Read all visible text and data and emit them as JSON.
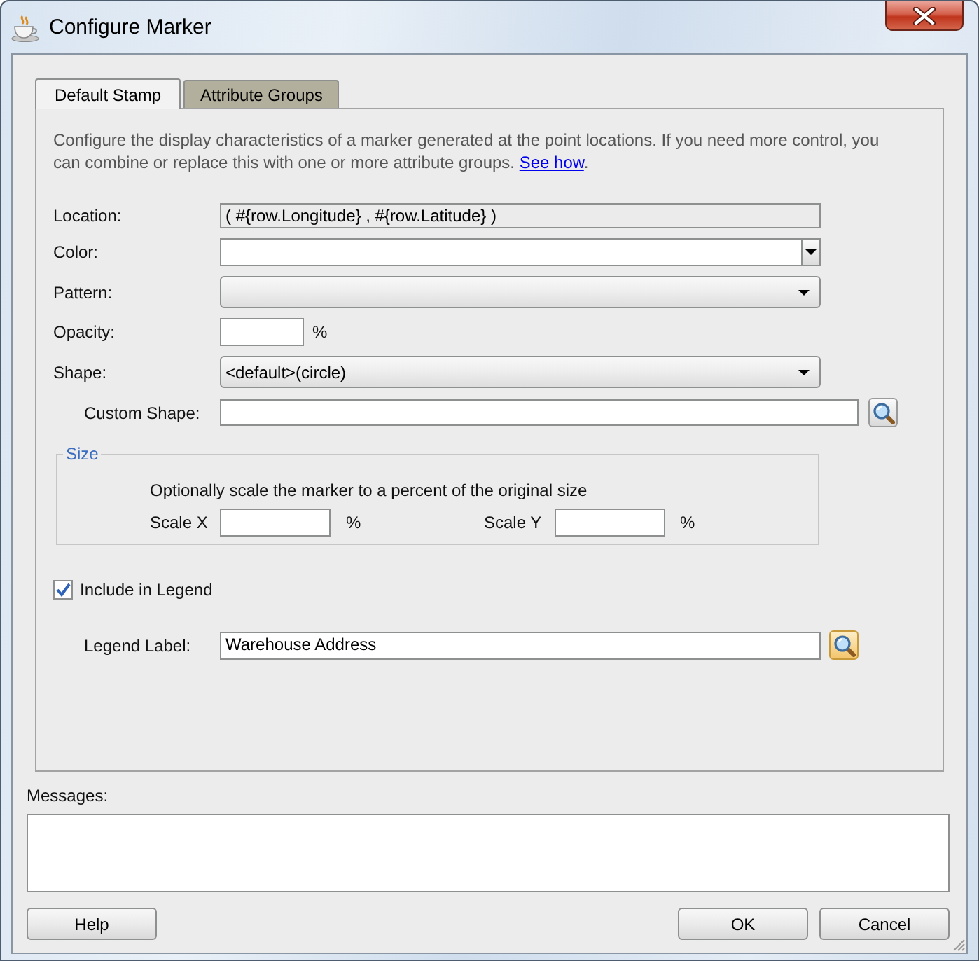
{
  "window": {
    "title": "Configure Marker"
  },
  "tabs": [
    {
      "label": "Default Stamp",
      "selected": true
    },
    {
      "label": "Attribute Groups",
      "selected": false
    }
  ],
  "description": {
    "text": "Configure the display characteristics of a marker generated at the point locations. If you need more control, you can combine or replace this with one or more attribute groups.",
    "link": "See how",
    "end": "."
  },
  "fields": [
    {
      "kind": "readonly",
      "label": "Location:",
      "value": "( #{row.Longitude} , #{row.Latitude} )"
    },
    {
      "kind": "editable-combo",
      "label": "Color:"
    },
    {
      "kind": "combo",
      "label": "Pattern:"
    },
    {
      "kind": "percent",
      "label": "Opacity:",
      "unit": "%"
    },
    {
      "kind": "combo",
      "label": "Shape:",
      "value": "<default>(circle)",
      "children": [
        {
          "kind": "lookup",
          "label": "Custom Shape:",
          "highlighted": false
        }
      ]
    }
  ],
  "size": {
    "title": "Size",
    "hint": "Optionally scale the marker to a percent of the original size",
    "scales": [
      {
        "label": "Scale X",
        "unit": "%"
      },
      {
        "label": "Scale Y",
        "unit": "%"
      }
    ]
  },
  "legend": {
    "label": "Include in Legend",
    "checked": true,
    "children": [
      {
        "kind": "lookup",
        "label": "Legend Label:",
        "value": "Warehouse Address",
        "highlighted": true
      }
    ]
  },
  "messages": {
    "label": "Messages:"
  },
  "footer": {
    "help": {
      "label": "Help"
    },
    "buttons": [
      {
        "label": "OK"
      },
      {
        "label": "Cancel"
      }
    ]
  }
}
